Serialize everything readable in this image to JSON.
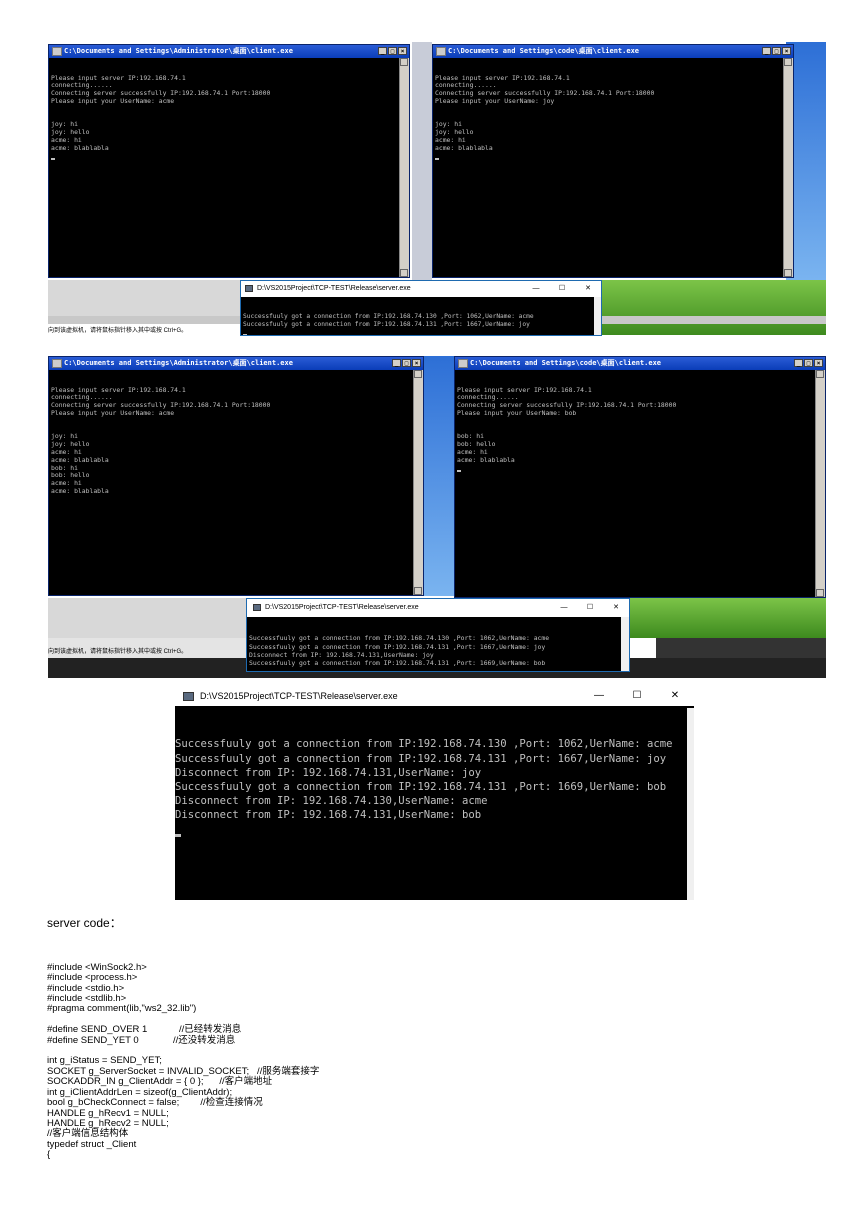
{
  "screenshot1": {
    "client_left": {
      "title": "C:\\Documents and Settings\\Administrator\\桌面\\client.exe",
      "lines": [
        "Please input server IP:192.168.74.1",
        "connecting......",
        "Connecting server successfully IP:192.168.74.1 Port:18000",
        "Please input your UserName: acme",
        "",
        "",
        "joy: hi",
        "joy: hello",
        "acme: hi",
        "acme: blablabla"
      ]
    },
    "client_right": {
      "title": "C:\\Documents and Settings\\code\\桌面\\client.exe",
      "lines": [
        "Please input server IP:192.168.74.1",
        "connecting......",
        "Connecting server successfully IP:192.168.74.1 Port:18000",
        "Please input your UserName: joy",
        "",
        "",
        "joy: hi",
        "joy: hello",
        "acme: hi",
        "acme: blablabla"
      ]
    },
    "server": {
      "title": "D:\\VS2015Project\\TCP-TEST\\Release\\server.exe",
      "lines": [
        "Successfuuly got a connection from IP:192.168.74.130 ,Port: 1062,UerName: acme",
        "Successfuuly got a connection from IP:192.168.74.131 ,Port: 1667,UerName: joy"
      ]
    },
    "hint": "向到该虚拟机，请将鼠标指针移入其中或按 Ctrl+G。"
  },
  "screenshot2": {
    "client_left": {
      "title": "C:\\Documents and Settings\\Administrator\\桌面\\client.exe",
      "lines": [
        "Please input server IP:192.168.74.1",
        "connecting......",
        "Connecting server successfully IP:192.168.74.1 Port:18000",
        "Please input your UserName: acme",
        "",
        "",
        "joy: hi",
        "joy: hello",
        "acme: hi",
        "acme: blablabla",
        "bob: hi",
        "bob: hello",
        "acme: hi",
        "acme: blablabla"
      ]
    },
    "client_right": {
      "title": "C:\\Documents and Settings\\code\\桌面\\client.exe",
      "lines": [
        "Please input server IP:192.168.74.1",
        "connecting......",
        "Connecting server successfully IP:192.168.74.1 Port:18000",
        "Please input your UserName: bob",
        "",
        "",
        "bob: hi",
        "bob: hello",
        "acme: hi",
        "acme: blablabla"
      ]
    },
    "server": {
      "title": "D:\\VS2015Project\\TCP-TEST\\Release\\server.exe",
      "lines": [
        "Successfuuly got a connection from IP:192.168.74.130 ,Port: 1062,UerName: acme",
        "Successfuuly got a connection from IP:192.168.74.131 ,Port: 1667,UerName: joy",
        "Disconnect from IP: 192.168.74.131,UserName: joy",
        "Successfuuly got a connection from IP:192.168.74.131 ,Port: 1669,UerName: bob"
      ]
    },
    "hint": "向到该虚拟机，请将鼠标指针移入其中或按 Ctrl+G。"
  },
  "screenshot3": {
    "server": {
      "title": "D:\\VS2015Project\\TCP-TEST\\Release\\server.exe",
      "lines": [
        "Successfuuly got a connection from IP:192.168.74.130 ,Port: 1062,UerName: acme",
        "Successfuuly got a connection from IP:192.168.74.131 ,Port: 1667,UerName: joy",
        "Disconnect from IP: 192.168.74.131,UserName: joy",
        "Successfuuly got a connection from IP:192.168.74.131 ,Port: 1669,UerName: bob",
        "Disconnect from IP: 192.168.74.130,UserName: acme",
        "Disconnect from IP: 192.168.74.131,UserName: bob"
      ]
    }
  },
  "heading": "server code：",
  "code_lines": [
    "#include <WinSock2.h>",
    "#include <process.h>",
    "#include <stdio.h>",
    "#include <stdlib.h>",
    "#pragma comment(lib,\"ws2_32.lib\")",
    "",
    "#define SEND_OVER 1            //已经转发消息",
    "#define SEND_YET 0             //还没转发消息",
    "",
    "int g_iStatus = SEND_YET;",
    "SOCKET g_ServerSocket = INVALID_SOCKET;   //服务端套接字",
    "SOCKADDR_IN g_ClientAddr = { 0 };      //客户端地址",
    "int g_iClientAddrLen = sizeof(g_ClientAddr);",
    "bool g_bCheckConnect = false;        //检查连接情况",
    "HANDLE g_hRecv1 = NULL;",
    "HANDLE g_hRecv2 = NULL;",
    "//客户端信息结构体",
    "typedef struct _Client",
    "{"
  ],
  "title_buttons": {
    "min": "_",
    "max": "□",
    "close": "×"
  },
  "w10_buttons": {
    "min": "—",
    "max": "☐",
    "close": "✕"
  }
}
